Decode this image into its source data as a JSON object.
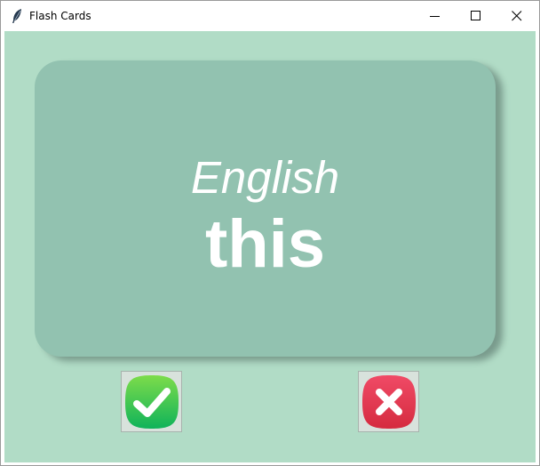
{
  "window": {
    "title": "Flash Cards",
    "app_icon": "feather-icon",
    "controls": [
      "minimize-icon",
      "maximize-icon",
      "close-icon"
    ]
  },
  "card": {
    "language": "English",
    "word": "this"
  },
  "actions": {
    "known_icon": "checkmark-icon",
    "unknown_icon": "cross-icon"
  },
  "colors": {
    "background": "#b1dcc6",
    "card": "#92c2b0",
    "card_text": "#ffffff",
    "known_button": "#22c25a",
    "unknown_button": "#e33450"
  }
}
